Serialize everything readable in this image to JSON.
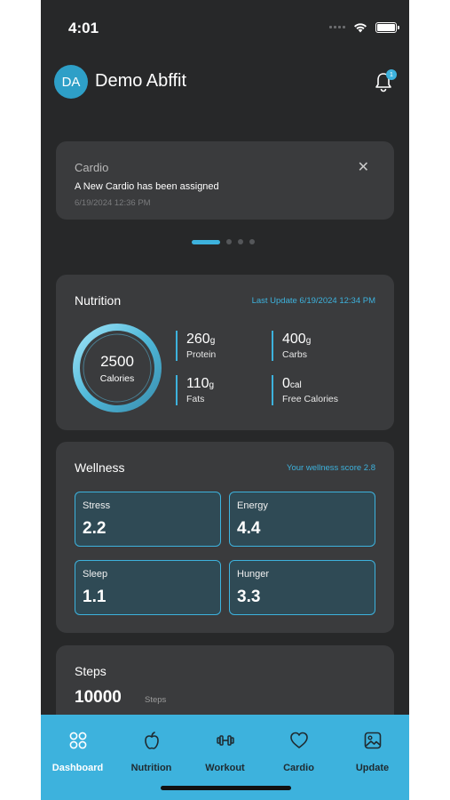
{
  "status_bar": {
    "time": "4:01"
  },
  "header": {
    "avatar_initials": "DA",
    "user_name": "Demo Abffit",
    "notification_count": "1"
  },
  "notification": {
    "title": "Cardio",
    "message": "A New Cardio  has been assigned",
    "timestamp": "6/19/2024 12:36 PM",
    "close_icon": "close-icon"
  },
  "carousel": {
    "pages": 4,
    "active_index": 0
  },
  "nutrition": {
    "title": "Nutrition",
    "last_update": "Last Update 6/19/2024 12:34 PM",
    "calories_value": "2500",
    "calories_label": "Calories",
    "macros": [
      {
        "value": "260",
        "unit": "g",
        "label": "Protein"
      },
      {
        "value": "400",
        "unit": "g",
        "label": "Carbs"
      },
      {
        "value": "110",
        "unit": "g",
        "label": "Fats"
      },
      {
        "value": "0",
        "unit": "cal",
        "label": "Free Calories"
      }
    ]
  },
  "wellness": {
    "title": "Wellness",
    "score_text": "Your wellness score 2.8",
    "items": [
      {
        "label": "Stress",
        "value": "2.2"
      },
      {
        "label": "Energy",
        "value": "4.4"
      },
      {
        "label": "Sleep",
        "value": "1.1"
      },
      {
        "label": "Hunger",
        "value": "3.3"
      }
    ]
  },
  "steps": {
    "title": "Steps",
    "value": "10000",
    "unit": "Steps"
  },
  "tabbar": {
    "items": [
      {
        "label": "Dashboard",
        "icon": "dashboard-icon",
        "active": true
      },
      {
        "label": "Nutrition",
        "icon": "apple-icon",
        "active": false
      },
      {
        "label": "Workout",
        "icon": "dumbbell-icon",
        "active": false
      },
      {
        "label": "Cardio",
        "icon": "heart-icon",
        "active": false
      },
      {
        "label": "Update",
        "icon": "image-icon",
        "active": false
      }
    ]
  },
  "colors": {
    "accent": "#3db2dd",
    "background": "#272829",
    "card": "#3a3b3d",
    "tile": "#2f4a55"
  }
}
